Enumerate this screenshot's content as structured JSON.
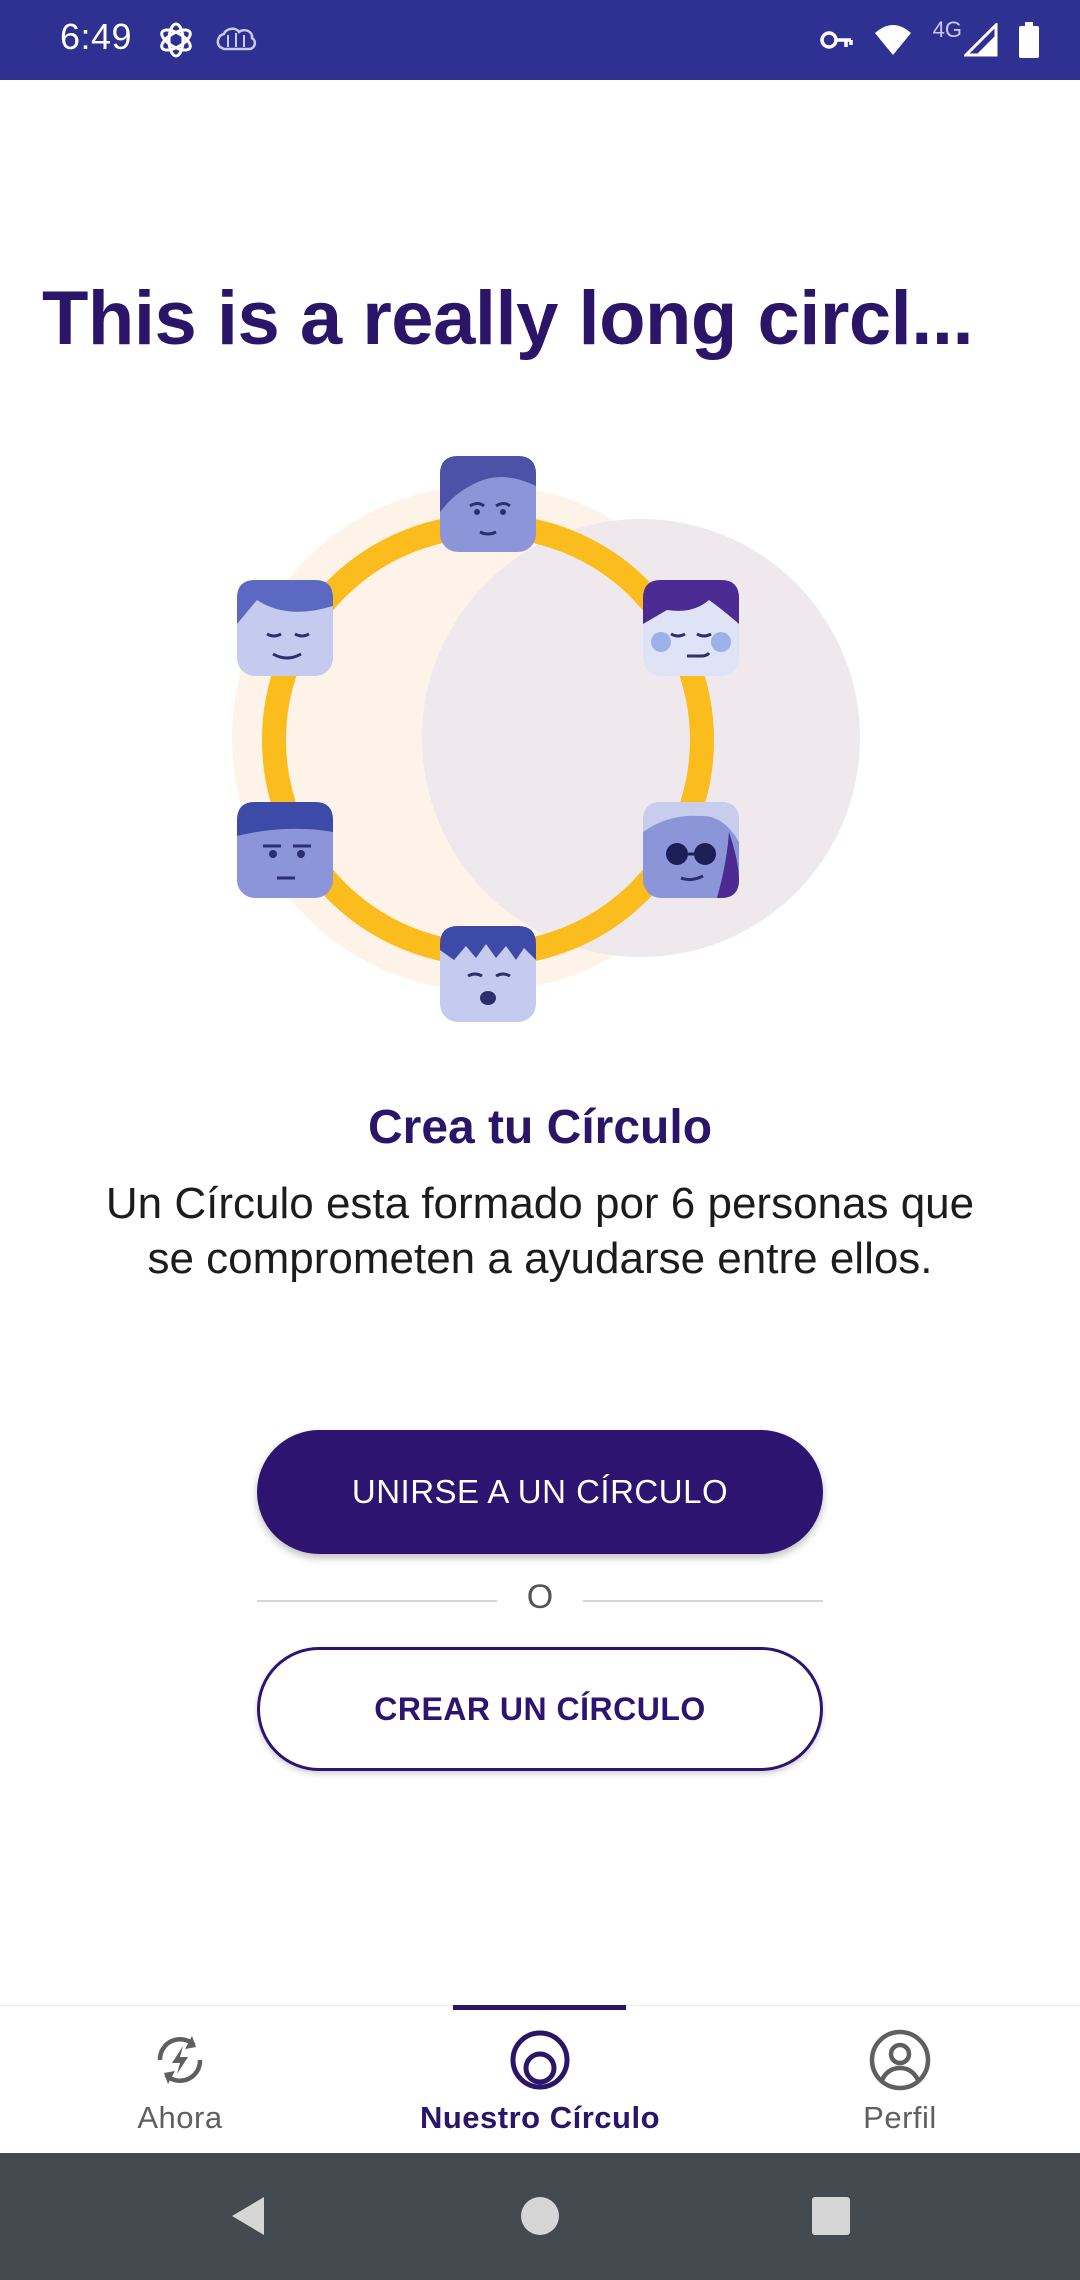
{
  "status_bar": {
    "time": "6:49",
    "network_label": "4G",
    "icons": [
      "openai-icon",
      "brain-icon",
      "vpn-key-icon",
      "wifi-icon",
      "signal-icon",
      "battery-icon"
    ],
    "background_color": "#2e3192"
  },
  "page": {
    "title": "This is a really long circl..."
  },
  "illustration": {
    "description_icons": [
      "face-top-icon",
      "face-upper-left-icon",
      "face-upper-right-icon",
      "face-lower-left-icon",
      "face-lower-right-icon",
      "face-bottom-icon"
    ],
    "ring_color": "#fbbc1e"
  },
  "intro": {
    "heading": "Crea tu Círculo",
    "description": "Un Círculo esta formado por 6 personas que se comprometen a ayudarse entre ellos."
  },
  "actions": {
    "join_label": "UNIRSE A UN CÍRCULO",
    "separator": "O",
    "create_label": "CREAR UN CÍRCULO",
    "primary_color": "#2e1471"
  },
  "bottom_nav": {
    "items": [
      {
        "label": "Ahora",
        "icon": "bolt-refresh-icon",
        "active": false
      },
      {
        "label": "Nuestro Círculo",
        "icon": "circle-icon",
        "active": true
      },
      {
        "label": "Perfil",
        "icon": "profile-icon",
        "active": false
      }
    ]
  },
  "system_nav": {
    "buttons": [
      "back-icon",
      "home-icon",
      "recents-icon"
    ]
  }
}
